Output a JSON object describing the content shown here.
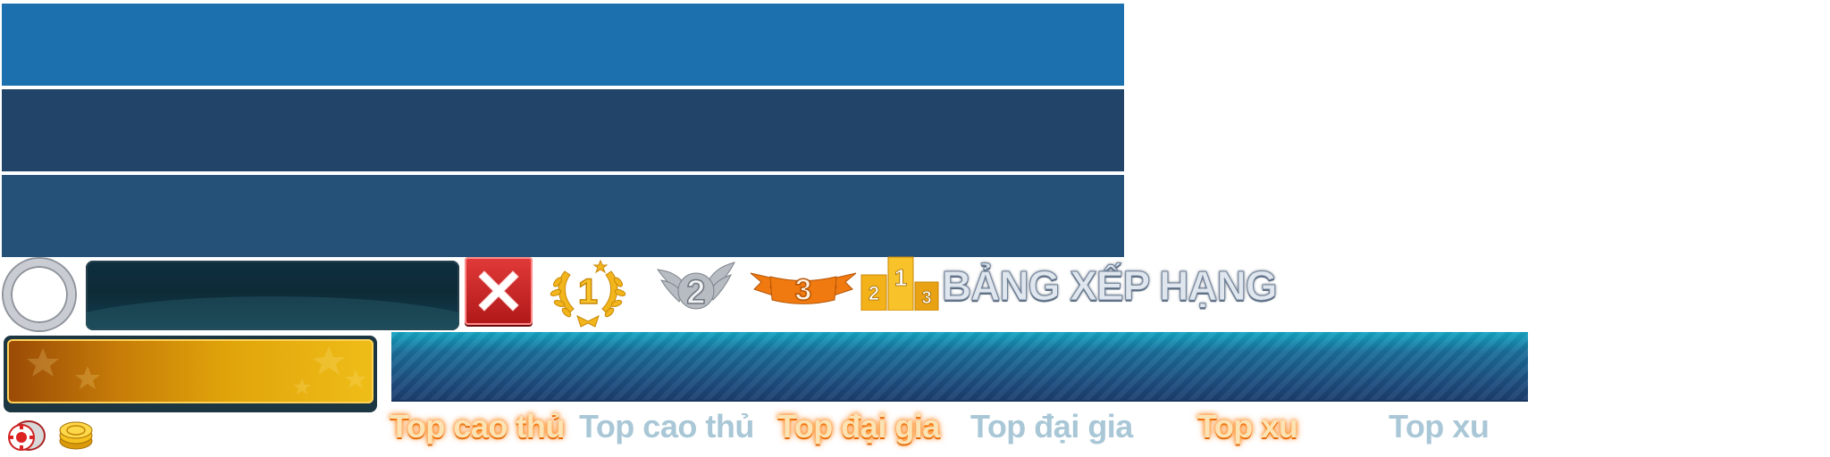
{
  "title_banner": "BẢNG XẾP HẠNG",
  "tabs": [
    {
      "label": "Top cao thủ",
      "state": "active"
    },
    {
      "label": "Top cao thủ",
      "state": "inactive"
    },
    {
      "label": "Top đại gia",
      "state": "active"
    },
    {
      "label": "Top đại gia",
      "state": "inactive"
    },
    {
      "label": "Top xu",
      "state": "active"
    },
    {
      "label": "Top xu",
      "state": "inactive"
    }
  ],
  "rank_badges": [
    {
      "icon": "rank-1-laurel-icon",
      "number": "1"
    },
    {
      "icon": "rank-2-wings-icon",
      "number": "2"
    },
    {
      "icon": "rank-3-ribbon-icon",
      "number": "3"
    }
  ],
  "podium": {
    "icon": "podium-icon",
    "places": [
      "2",
      "1",
      "3"
    ]
  },
  "colors": {
    "panel_1": "#1b70ad",
    "panel_2": "#214468",
    "panel_3": "#255178",
    "close_red": "#c92424",
    "gold": "#f2b51c",
    "silver": "#9aa0a8",
    "bronze": "#f07a10",
    "tab_active": "#fbe3b4",
    "tab_inactive": "#a9c7d6"
  },
  "icons": {
    "close": "close-x-icon",
    "avatar_frame": "avatar-ring-icon",
    "chip": "poker-chip-icon",
    "coin": "gold-coin-icon"
  }
}
